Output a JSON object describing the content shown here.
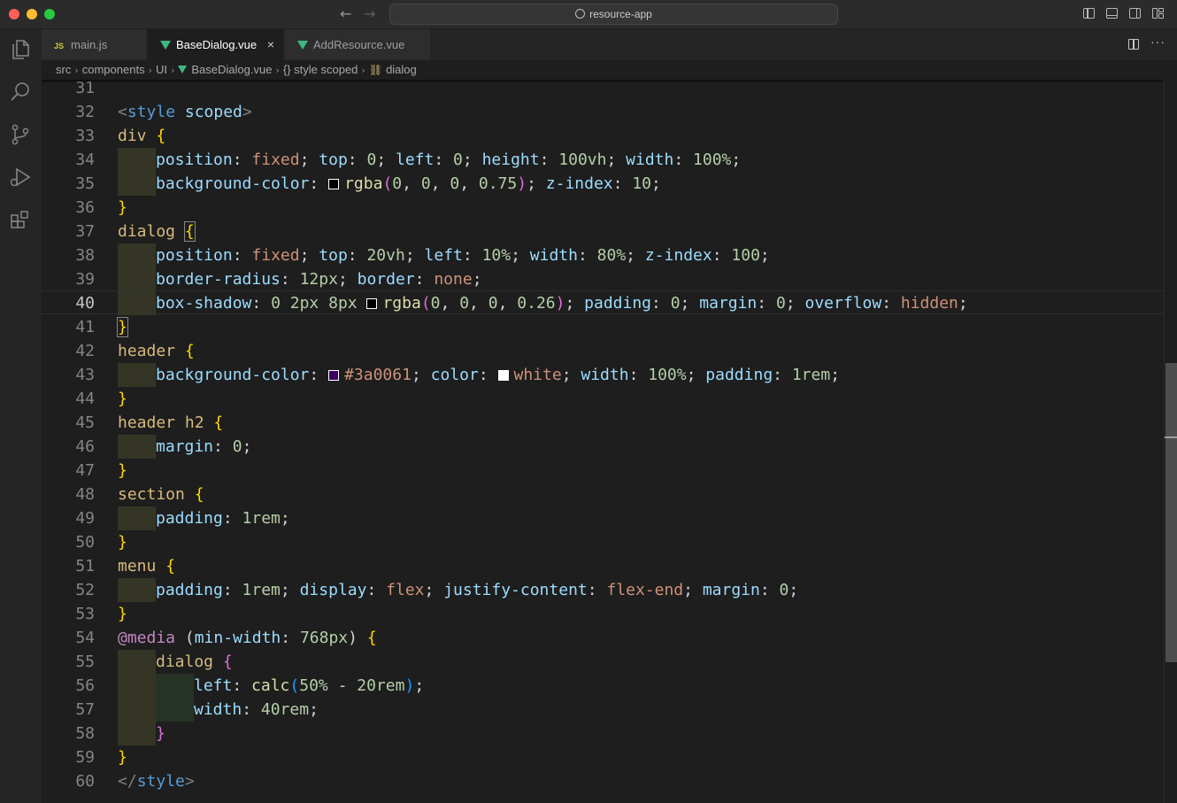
{
  "window": {
    "search_text": "resource-app"
  },
  "tabs": [
    {
      "label": "main.js",
      "icon": "js-icon"
    },
    {
      "label": "BaseDialog.vue",
      "icon": "vue-icon",
      "close": "×"
    },
    {
      "label": "AddResource.vue",
      "icon": "vue-icon"
    }
  ],
  "breadcrumb": {
    "src": "src",
    "components": "components",
    "ui": "UI",
    "file": "BaseDialog.vue",
    "style": "{} style scoped",
    "symbol": "dialog"
  },
  "line_numbers": [
    "31",
    "32",
    "33",
    "34",
    "35",
    "36",
    "37",
    "38",
    "39",
    "40",
    "41",
    "42",
    "43",
    "44",
    "45",
    "46",
    "47",
    "48",
    "49",
    "50",
    "51",
    "52",
    "53",
    "54",
    "55",
    "56",
    "57",
    "58",
    "59",
    "60"
  ],
  "current_line": "40",
  "colors": {
    "dialog_purple": "#3a0061",
    "white": "#ffffff",
    "black_swatch": "#000000"
  },
  "code": {
    "style_open_lt": "<",
    "style_open_tag": "style",
    "style_open_attr": "scoped",
    "style_open_gt": ">",
    "div": "div",
    "header": "header",
    "header_h2": "header h2",
    "section": "section",
    "menu": "menu",
    "dialog": "dialog",
    "media": "@media",
    "media_cond_prop": "min-width",
    "media_cond_val": "768px",
    "close_tag_lt": "</",
    "close_tag_name": "style",
    "close_tag_gt": ">",
    "ob": "{",
    "cb": "}",
    "position": "position",
    "top": "top",
    "left": "left",
    "height": "height",
    "width": "width",
    "background_color": "background-color",
    "z_index": "z-index",
    "border_radius": "border-radius",
    "border": "border",
    "box_shadow": "box-shadow",
    "padding": "padding",
    "margin": "margin",
    "overflow": "overflow",
    "color": "color",
    "display": "display",
    "justify_content": "justify-content",
    "fixed": "fixed",
    "none": "none",
    "hidden": "hidden",
    "flex": "flex",
    "flex_end": "flex-end",
    "white": "white",
    "hex_color": "#3a0061",
    "rgba": "rgba",
    "calc": "calc",
    "zero": "0",
    "v100vh": "100vh",
    "v100pct": "100%",
    "v075": "0.75",
    "v10": "10",
    "v20vh": "20vh",
    "v10pct": "10%",
    "v80pct": "80%",
    "v100": "100",
    "v12px": "12px",
    "v2px": "2px",
    "v8px": "8px",
    "v026": "0.26",
    "v1rem": "1rem",
    "v50pct": "50%",
    "v20rem": "20rem",
    "v40rem": "40rem",
    "minus": "-"
  }
}
